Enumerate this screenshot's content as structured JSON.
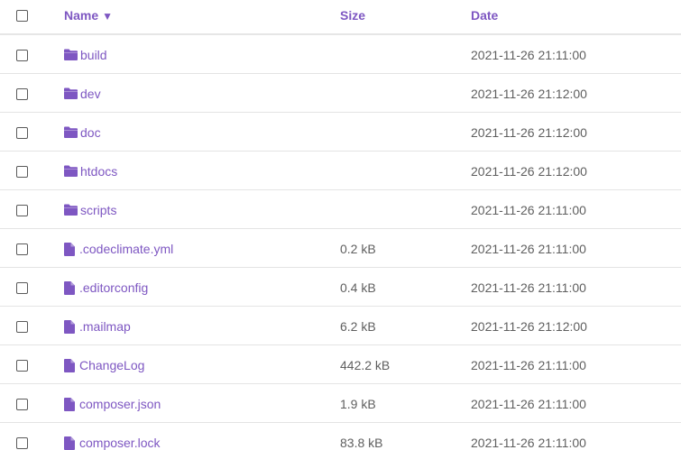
{
  "columns": {
    "name": "Name",
    "sort_indicator": "▼",
    "size": "Size",
    "date": "Date"
  },
  "colors": {
    "accent": "#7e57c2",
    "text": "#5f5f5f",
    "divider": "#e4e4e4"
  },
  "rows": [
    {
      "type": "folder",
      "icon": "folder-icon",
      "name": "build",
      "size": "",
      "date": "2021-11-26 21:11:00"
    },
    {
      "type": "folder",
      "icon": "folder-icon",
      "name": "dev",
      "size": "",
      "date": "2021-11-26 21:12:00"
    },
    {
      "type": "folder",
      "icon": "folder-icon",
      "name": "doc",
      "size": "",
      "date": "2021-11-26 21:12:00"
    },
    {
      "type": "folder",
      "icon": "folder-icon",
      "name": "htdocs",
      "size": "",
      "date": "2021-11-26 21:12:00"
    },
    {
      "type": "folder",
      "icon": "folder-icon",
      "name": "scripts",
      "size": "",
      "date": "2021-11-26 21:11:00"
    },
    {
      "type": "file",
      "icon": "file-icon",
      "name": ".codeclimate.yml",
      "size": "0.2 kB",
      "date": "2021-11-26 21:11:00"
    },
    {
      "type": "file",
      "icon": "file-icon",
      "name": ".editorconfig",
      "size": "0.4 kB",
      "date": "2021-11-26 21:11:00"
    },
    {
      "type": "file",
      "icon": "file-icon",
      "name": ".mailmap",
      "size": "6.2 kB",
      "date": "2021-11-26 21:12:00"
    },
    {
      "type": "file",
      "icon": "file-icon",
      "name": "ChangeLog",
      "size": "442.2 kB",
      "date": "2021-11-26 21:11:00"
    },
    {
      "type": "file",
      "icon": "file-icon",
      "name": "composer.json",
      "size": "1.9 kB",
      "date": "2021-11-26 21:11:00"
    },
    {
      "type": "file",
      "icon": "file-icon",
      "name": "composer.lock",
      "size": "83.8 kB",
      "date": "2021-11-26 21:11:00"
    }
  ]
}
